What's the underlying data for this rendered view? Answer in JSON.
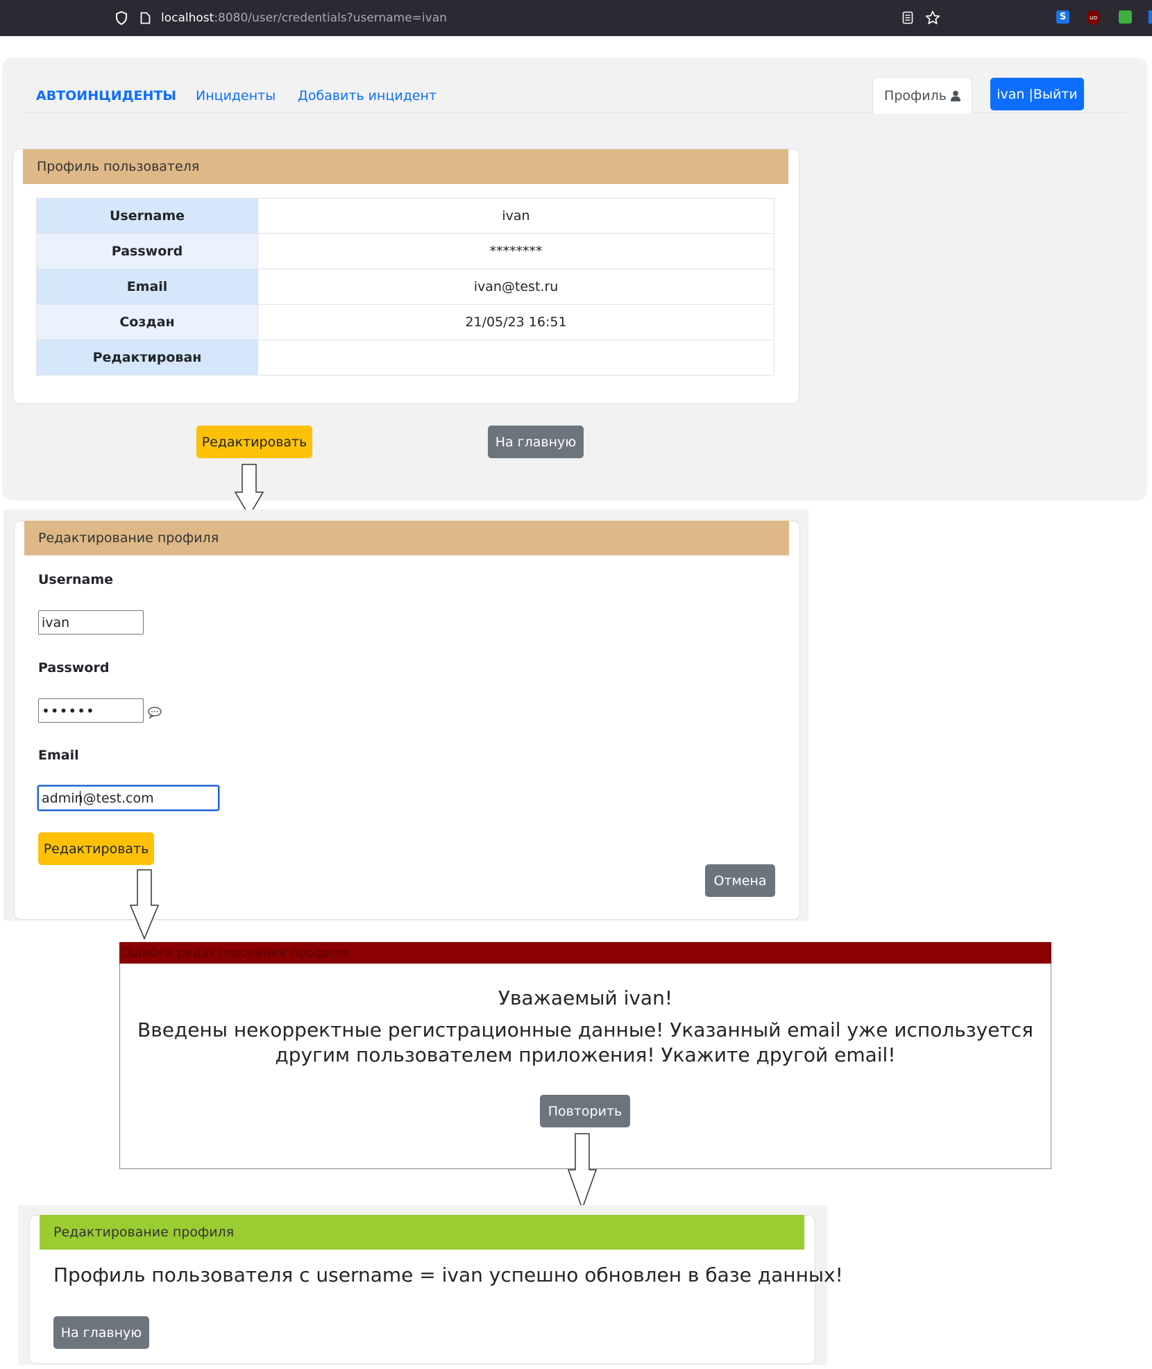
{
  "browser": {
    "url_host": "localhost",
    "url_rest": ":8080/user/credentials?username=ivan",
    "icons": [
      "shield-icon",
      "page-icon",
      "reader-icon",
      "star-icon",
      "extension-s-icon",
      "ublock-icon",
      "extension-green-icon"
    ]
  },
  "nav": {
    "brand": "АВТОИНЦИДЕНТЫ",
    "incidents": "Инциденты",
    "add_incident": "Добавить инцидент",
    "profile": "Профиль",
    "logout": "ivan |Выйти"
  },
  "profile_card": {
    "header": "Профиль пользователя",
    "rows": [
      {
        "key": "Username",
        "value": "ivan"
      },
      {
        "key": "Password",
        "value": "********"
      },
      {
        "key": "Email",
        "value": "ivan@test.ru"
      },
      {
        "key": "Создан",
        "value": "21/05/23 16:51"
      },
      {
        "key": "Редактирован",
        "value": ""
      }
    ],
    "edit_button": "Редактировать",
    "home_button": "На главную"
  },
  "edit_form": {
    "header": "Редактирование профиля",
    "username_label": "Username",
    "username_value": "ivan",
    "password_label": "Password",
    "password_value": "••••••",
    "email_label": "Email",
    "email_value": "admin@test.com",
    "submit_button": "Редактировать",
    "cancel_button": "Отмена"
  },
  "error_dialog": {
    "header": "Ошибка редактирования профиля",
    "greeting": "Уважаемый ivan!",
    "message_line1": "Введены некорректные регистрационные данные! Указанный email уже используется",
    "message_line2": "другим пользователем приложения! Укажите другой email!",
    "retry_button": "Повторить"
  },
  "success_card": {
    "header": "Редактирование профиля",
    "message": "Профиль пользователя с username = ivan успешно обновлен в базе данных!",
    "home_button": "На главную"
  },
  "colors": {
    "browser_bar": "#2b2a33",
    "primary": "#0d6efd",
    "warning": "#ffc107",
    "secondary": "#6c757d",
    "card_header": "#deb887",
    "error_header": "#8b0000",
    "success_header": "#9acd32"
  }
}
